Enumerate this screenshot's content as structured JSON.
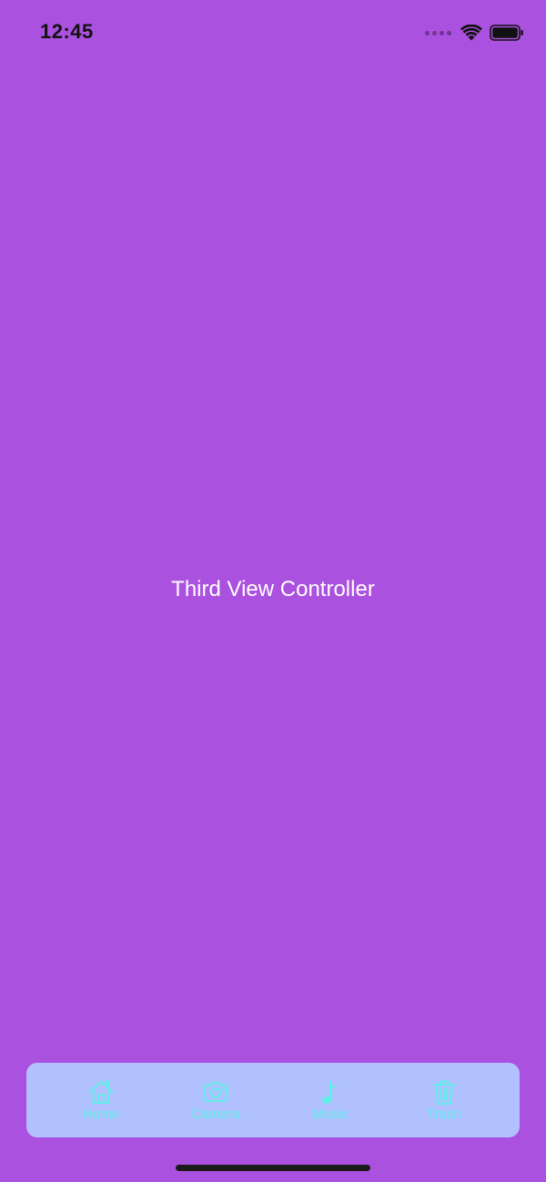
{
  "status_bar": {
    "time": "12:45"
  },
  "screen": {
    "title": "Third View Controller"
  },
  "tab_bar": {
    "items": [
      {
        "label": "Home",
        "icon": "home-icon"
      },
      {
        "label": "Camera",
        "icon": "camera-icon"
      },
      {
        "label": "Music",
        "icon": "music-note-icon"
      },
      {
        "label": "Trash",
        "icon": "trash-icon"
      }
    ]
  },
  "colors": {
    "background": "#ab51df",
    "tab_bar_background": "#b1c1ff",
    "tab_tint": "#62eee8",
    "title_text": "#ffffff"
  }
}
